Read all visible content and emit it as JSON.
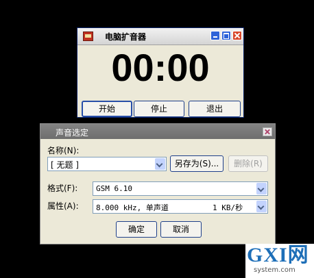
{
  "recorder": {
    "title": "电脑扩音器",
    "timer": "00:00",
    "buttons": {
      "start": "开始",
      "stop": "停止",
      "exit": "退出"
    }
  },
  "sound_dialog": {
    "title": "声音选定",
    "name_label": "名称(N):",
    "name_value": "[ 无题 ]",
    "save_as": "另存为(S)...",
    "delete": "删除(R)",
    "format_label": "格式(F):",
    "format_value": "GSM 6.10",
    "attributes_label": "属性(A):",
    "attributes_value": "8.000 kHz, 单声道",
    "attributes_rate": "1 KB/秒",
    "ok": "确定",
    "cancel": "取消"
  },
  "watermark": {
    "logo": "GXI网",
    "domain": "system.com"
  },
  "colors": {
    "desktop": "#000000",
    "dialog_bg": "#ECE9D8",
    "active_accent": "#2E63D8",
    "close_red": "#D8472B"
  }
}
